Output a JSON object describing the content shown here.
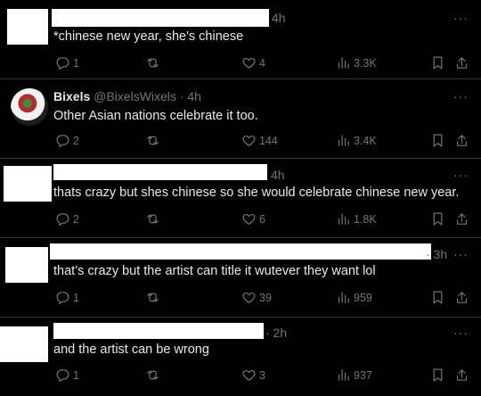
{
  "tweets": [
    {
      "name": "",
      "handle": "",
      "time": "4h",
      "text": "*chinese new year, she's chinese",
      "replies": "1",
      "reposts": "",
      "likes": "4",
      "views": "3.3K"
    },
    {
      "name": "Bixels",
      "handle": "@BixelsWixels",
      "time": "· 4h",
      "text": "Other Asian nations celebrate it too.",
      "replies": "2",
      "reposts": "",
      "likes": "144",
      "views": "3.4K"
    },
    {
      "name": "",
      "handle": "",
      "time": "4h",
      "text": "thats crazy but shes chinese so she would celebrate chinese new year.",
      "replies": "2",
      "reposts": "",
      "likes": "6",
      "views": "1.8K"
    },
    {
      "name": "",
      "handle": "",
      "time": "· 3h",
      "text": "that’s crazy but the artist can title it wutever they want lol",
      "replies": "1",
      "reposts": "",
      "likes": "39",
      "views": "959"
    },
    {
      "name": "",
      "handle": "",
      "time": "· 2h",
      "text": "and the artist can be wrong",
      "replies": "1",
      "reposts": "",
      "likes": "3",
      "views": "937"
    }
  ],
  "more_label": "···",
  "colors": {
    "background": "#000000",
    "text": "#e7e9ea",
    "muted": "#71767b",
    "divider": "#2f3336"
  }
}
